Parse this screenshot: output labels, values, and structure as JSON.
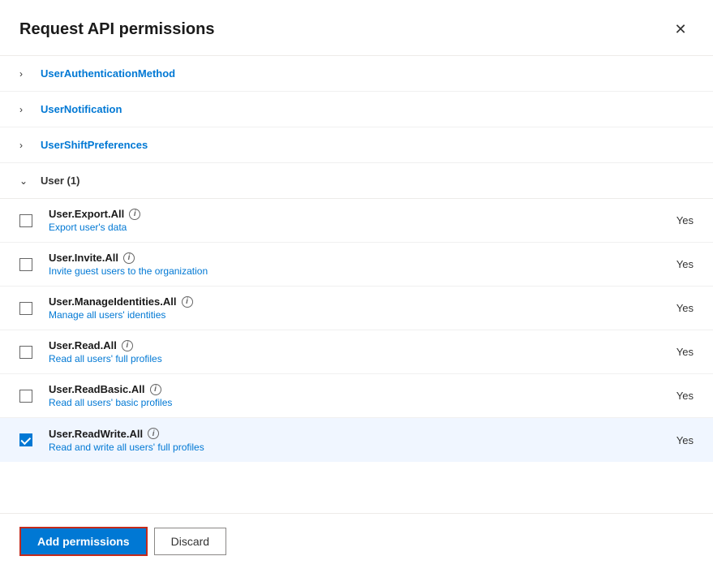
{
  "dialog": {
    "title": "Request API permissions",
    "close_label": "×"
  },
  "sections_collapsed": [
    {
      "id": "user-auth",
      "label": "UserAuthenticationMethod"
    },
    {
      "id": "user-notif",
      "label": "UserNotification"
    },
    {
      "id": "user-shift",
      "label": "UserShiftPreferences"
    }
  ],
  "expanded_section": {
    "label": "User (1)"
  },
  "permissions": [
    {
      "id": "user-export",
      "name": "User.Export.All",
      "description": "Export user's data",
      "admin_consent": "Yes",
      "checked": false
    },
    {
      "id": "user-invite",
      "name": "User.Invite.All",
      "description": "Invite guest users to the organization",
      "admin_consent": "Yes",
      "checked": false
    },
    {
      "id": "user-manage-identities",
      "name": "User.ManageIdentities.All",
      "description": "Manage all users' identities",
      "admin_consent": "Yes",
      "checked": false
    },
    {
      "id": "user-read",
      "name": "User.Read.All",
      "description": "Read all users' full profiles",
      "admin_consent": "Yes",
      "checked": false
    },
    {
      "id": "user-readbasic",
      "name": "User.ReadBasic.All",
      "description": "Read all users' basic profiles",
      "admin_consent": "Yes",
      "checked": false
    },
    {
      "id": "user-readwrite",
      "name": "User.ReadWrite.All",
      "description": "Read and write all users' full profiles",
      "admin_consent": "Yes",
      "checked": true
    }
  ],
  "footer": {
    "add_button_label": "Add permissions",
    "discard_button_label": "Discard"
  },
  "icons": {
    "info": "i",
    "chevron_right": "›",
    "chevron_down": "∨",
    "close": "✕"
  }
}
